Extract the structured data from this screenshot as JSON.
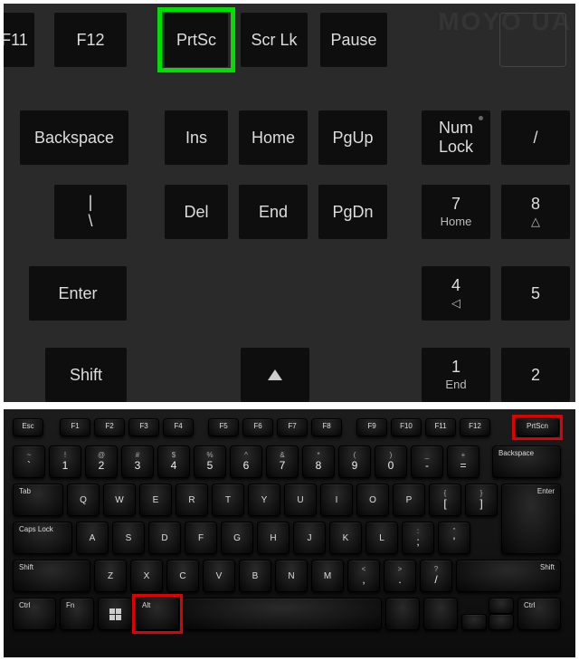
{
  "watermark": "MOYO UA",
  "top_keyboard": {
    "row1": {
      "f11": "F11",
      "f12": "F12",
      "prtsc": "PrtSc",
      "scrlk": "Scr Lk",
      "pause": "Pause"
    },
    "row2": {
      "backspace": "Backspace",
      "ins": "Ins",
      "home": "Home",
      "pgup": "PgUp",
      "numlock_l1": "Num",
      "numlock_l2": "Lock",
      "slash": "/"
    },
    "row3": {
      "pipe": "|",
      "backslash": "\\",
      "del": "Del",
      "end": "End",
      "pgdn": "PgDn",
      "seven": "7",
      "seven_sub": "Home",
      "eight": "8",
      "eight_sub": "△"
    },
    "row4": {
      "enter": "Enter",
      "four": "4",
      "four_sub": "◁",
      "five": "5"
    },
    "row5": {
      "shift": "Shift",
      "one": "1",
      "one_sub": "End",
      "two": "2"
    }
  },
  "bottom_keyboard": {
    "fn_row": [
      "Esc",
      "F1",
      "F2",
      "F3",
      "F4",
      "F5",
      "F6",
      "F7",
      "F8",
      "F9",
      "F10",
      "F11",
      "F12",
      "PrtScn"
    ],
    "num_row_top": [
      "~",
      "!",
      "@",
      "#",
      "$",
      "%",
      "^",
      "&",
      "*",
      "(",
      ")",
      "_",
      "+"
    ],
    "num_row_bottom": [
      "`",
      "1",
      "2",
      "3",
      "4",
      "5",
      "6",
      "7",
      "8",
      "9",
      "0",
      "-",
      "="
    ],
    "backspace": "Backspace",
    "tab": "Tab",
    "qwerty_row": [
      "Q",
      "W",
      "E",
      "R",
      "T",
      "Y",
      "U",
      "I",
      "O",
      "P"
    ],
    "bracket_l_top": "{",
    "bracket_l_bot": "[",
    "bracket_r_top": "}",
    "bracket_r_bot": "]",
    "capslock": "Caps Lock",
    "asdf_row": [
      "A",
      "S",
      "D",
      "F",
      "G",
      "H",
      "J",
      "K",
      "L"
    ],
    "semi_top": ":",
    "semi_bot": ";",
    "quote_top": "\"",
    "quote_bot": "'",
    "enter": "Enter",
    "shift_l": "Shift",
    "zxcv_row": [
      "Z",
      "X",
      "C",
      "V",
      "B",
      "N",
      "M"
    ],
    "comma_top": "<",
    "comma_bot": ",",
    "period_top": ">",
    "period_bot": ".",
    "slash_top": "?",
    "slash_bot": "/",
    "shift_r": "Shift",
    "ctrl_l": "Ctrl",
    "fn": "Fn",
    "alt": "Alt",
    "ctrl_r": "Ctrl",
    "highlighted_keys": [
      "PrtScn",
      "Alt"
    ]
  }
}
